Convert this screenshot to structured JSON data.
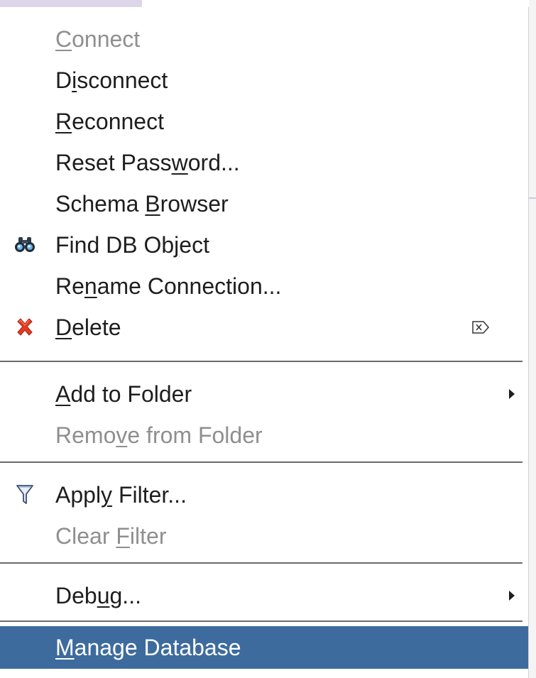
{
  "menu": {
    "items": [
      {
        "before": "",
        "mnemonic": "C",
        "after": "onnect",
        "disabled": true
      },
      {
        "before": "D",
        "mnemonic": "i",
        "after": "sconnect",
        "disabled": false
      },
      {
        "before": "",
        "mnemonic": "R",
        "after": "econnect",
        "disabled": false
      },
      {
        "before": "Reset Pass",
        "mnemonic": "w",
        "after": "ord...",
        "disabled": false
      },
      {
        "before": "Schema ",
        "mnemonic": "B",
        "after": "rowser",
        "disabled": false
      },
      {
        "before": "Find DB Ob",
        "mnemonic": "j",
        "after": "ect",
        "disabled": false,
        "icon": "binoculars-icon"
      },
      {
        "before": "Re",
        "mnemonic": "n",
        "after": "ame Connection...",
        "disabled": false
      },
      {
        "before": "",
        "mnemonic": "D",
        "after": "elete",
        "disabled": false,
        "icon": "red-x-delete-icon",
        "accelerator": "delete-key-icon"
      },
      {
        "before": "",
        "mnemonic": "A",
        "after": "dd to Folder",
        "disabled": false,
        "submenu": true
      },
      {
        "before": "Remo",
        "mnemonic": "v",
        "after": "e from Folder",
        "disabled": true
      },
      {
        "before": "Appl",
        "mnemonic": "y",
        "after": " Filter...",
        "disabled": false,
        "icon": "funnel-filter-icon"
      },
      {
        "before": "Clear ",
        "mnemonic": "F",
        "after": "ilter",
        "disabled": true
      },
      {
        "before": "Deb",
        "mnemonic": "u",
        "after": "g...",
        "disabled": false,
        "submenu": true
      },
      {
        "before": "",
        "mnemonic": "M",
        "after": "anage Database",
        "disabled": false,
        "selected": true
      }
    ]
  },
  "colors": {
    "selected_background": "#3d6b9e",
    "disabled_text": "#8f8f8f",
    "normal_text": "#1e1e1e"
  }
}
